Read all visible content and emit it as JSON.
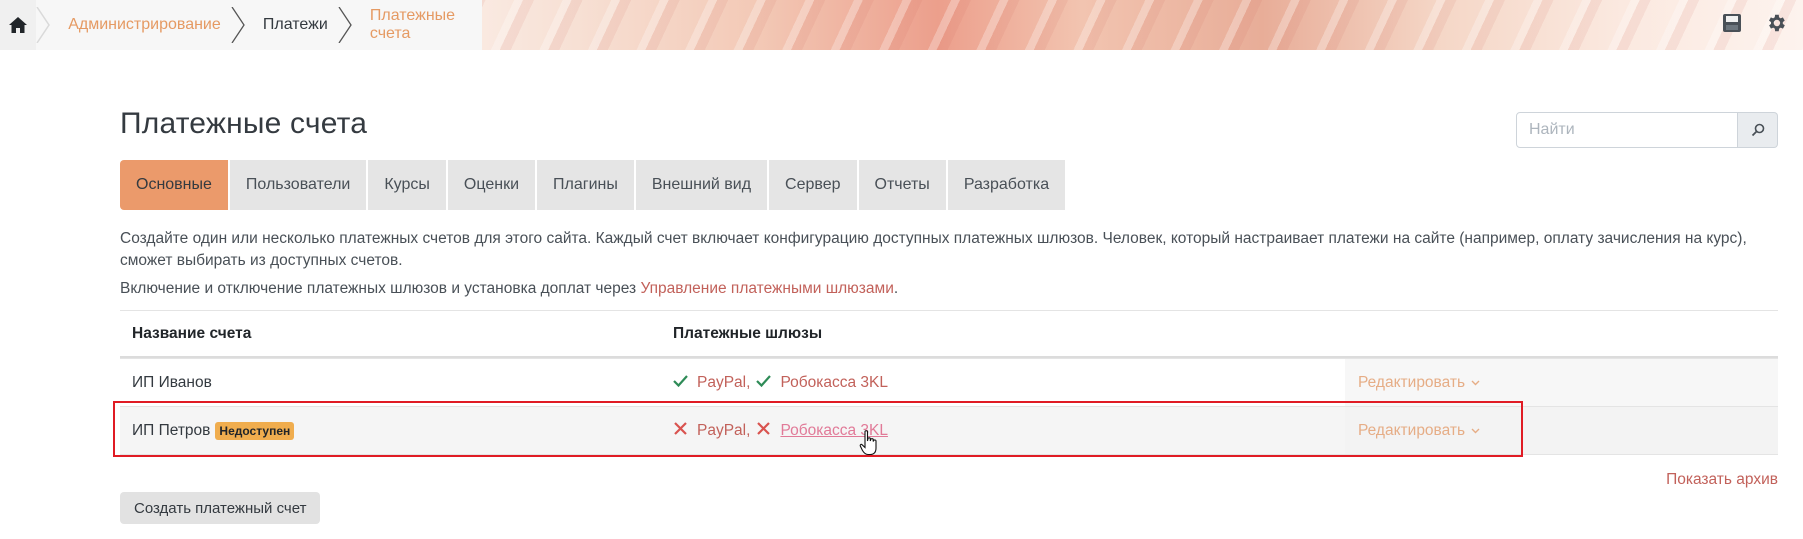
{
  "breadcrumb": {
    "items": [
      {
        "label": "Администрирование"
      },
      {
        "label": "Платежи"
      },
      {
        "label": "Платежные счета"
      }
    ]
  },
  "page": {
    "title": "Платежные счета",
    "search_placeholder": "Найти"
  },
  "tabs": [
    {
      "label": "Основные",
      "active": true
    },
    {
      "label": "Пользователи"
    },
    {
      "label": "Курсы"
    },
    {
      "label": "Оценки"
    },
    {
      "label": "Плагины"
    },
    {
      "label": "Внешний вид"
    },
    {
      "label": "Сервер"
    },
    {
      "label": "Отчеты"
    },
    {
      "label": "Разработка"
    }
  ],
  "content": {
    "description": "Создайте один или несколько платежных счетов для этого сайта. Каждый счет включает конфигурацию доступных платежных шлюзов. Человек, который настраивает платежи на сайте (например, оплату зачисления на курс), сможет выбирать из доступных счетов.",
    "gateway_text": "Включение и отключение платежных шлюзов и установка доплат через ",
    "gateway_link": "Управление платежными шлюзами",
    "gateway_end": "."
  },
  "table": {
    "headers": {
      "name": "Название счета",
      "gateways": "Платежные шлюзы"
    },
    "rows": [
      {
        "name": "ИП Иванов",
        "badge": "",
        "g1": "PayPal",
        "g2": "Робокасса 3KL",
        "sep": ",",
        "edit": "Редактировать",
        "status": "enabled"
      },
      {
        "name": "ИП Петров",
        "badge": "Недоступен",
        "g1": "PayPal",
        "g2": "Робокасса 3KL",
        "sep": ",",
        "edit": "Редактировать",
        "status": "disabled"
      }
    ]
  },
  "footer": {
    "archive_link": "Показать архив",
    "create_button": "Создать платежный счет"
  },
  "colors": {
    "accent": "#eb9a6b",
    "link": "#c2615a",
    "ok": "#2e8b57",
    "error": "#d9534f",
    "highlight": "#e01b24",
    "badge": "#f0ad4e"
  }
}
